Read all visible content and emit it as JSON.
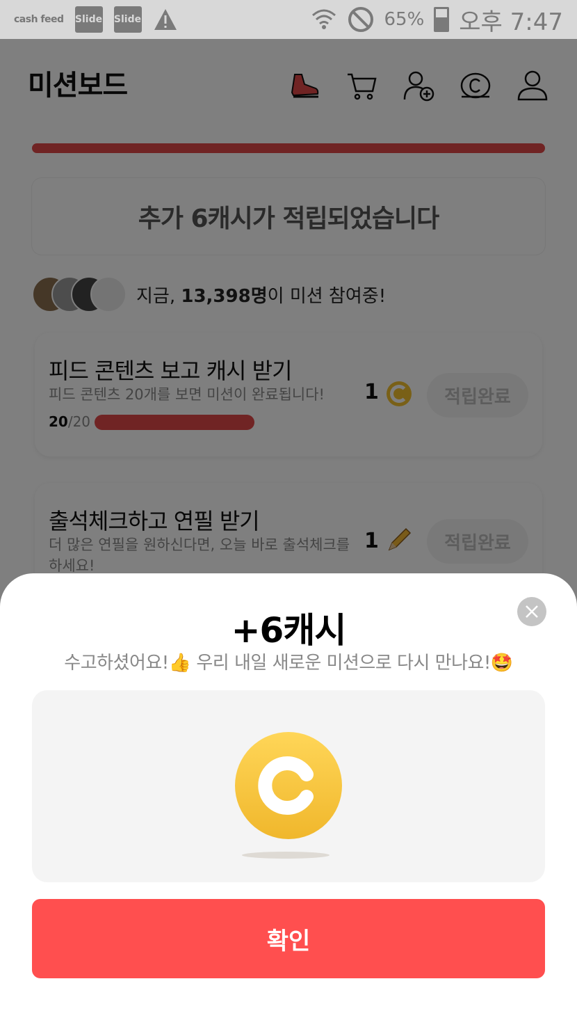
{
  "status_bar": {
    "app1": "cash feed",
    "app2": "Slide",
    "app3": "Slide",
    "battery": "65%",
    "time": "오후 7:47"
  },
  "header": {
    "title": "미션보드",
    "icons": [
      "sneaker-icon",
      "cart-icon",
      "add-user-icon",
      "coin-icon",
      "profile-icon"
    ]
  },
  "notice": "추가 6캐시가 적립되었습니다",
  "participants": {
    "prefix": "지금, ",
    "count": "13,398명",
    "suffix": "이 미션 참여중!"
  },
  "missions": [
    {
      "title": "피드 콘텐츠 보고 캐시 받기",
      "desc": "피드 콘텐츠 20개를 보면 미션이 완료됩니다!",
      "progress_done": "20",
      "progress_total": "/20",
      "progress_ratio": 1.0,
      "reward": "1",
      "button": "적립완료"
    },
    {
      "title": "출석체크하고 연필 받기",
      "desc": "더 많은 연필을 원하신다면, 오늘 바로 출석체크를 하세요!",
      "reward": "1",
      "button": "적립완료"
    }
  ],
  "sheet": {
    "title": "+6캐시",
    "subtitle": "수고하셨어요!👍 우리 내일 새로운 미션으로 다시 만나요!🤩",
    "confirm": "확인"
  },
  "colors": {
    "accent": "#ff4f4f",
    "progress": "#e04848",
    "coin": "#f2c12e"
  }
}
